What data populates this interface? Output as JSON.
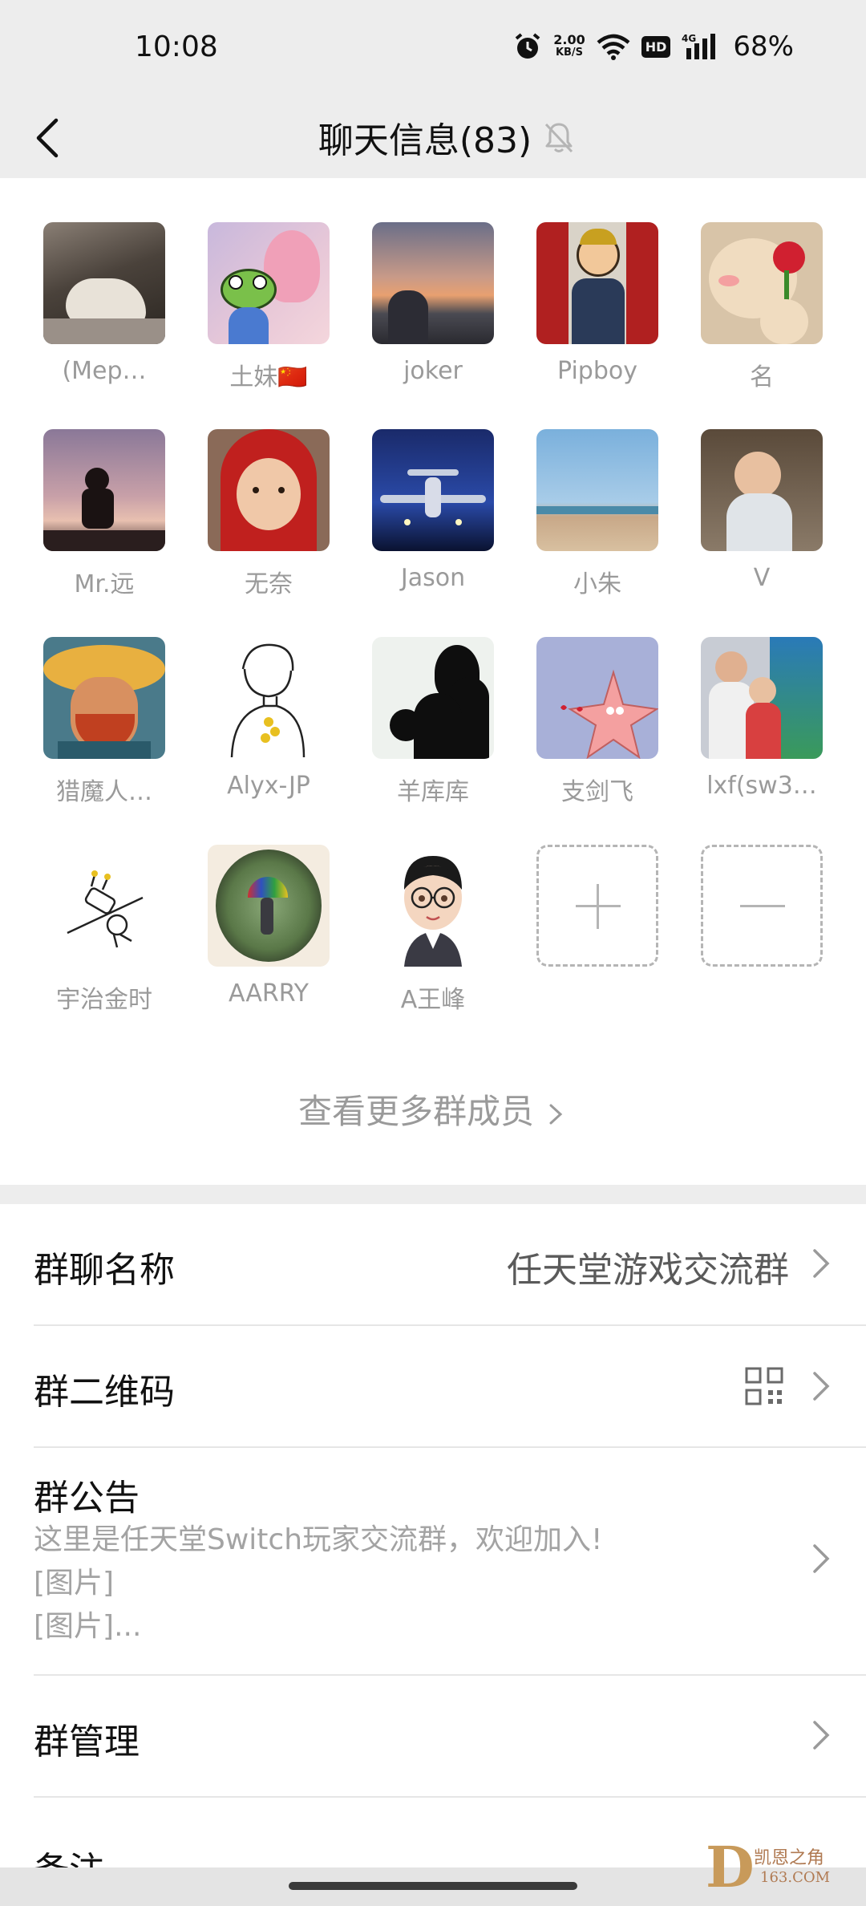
{
  "status_bar": {
    "time": "10:08",
    "speed_value": "2.00",
    "speed_unit": "KB/S",
    "hd_label": "HD",
    "network": "4G",
    "battery": "68%"
  },
  "nav": {
    "title": "聊天信息(83)"
  },
  "members": [
    {
      "name": "(Mep…",
      "avatar": "cat-on-sofa"
    },
    {
      "name": "土妹🇨🇳",
      "avatar": "frog-lotus"
    },
    {
      "name": "joker",
      "avatar": "sunset-city"
    },
    {
      "name": "Pipboy",
      "avatar": "pipboy-cartoon"
    },
    {
      "name": "名",
      "avatar": "cat-rose"
    },
    {
      "name": "Mr.远",
      "avatar": "silhouette-dusk"
    },
    {
      "name": "无奈",
      "avatar": "baby-red-hood"
    },
    {
      "name": "Jason",
      "avatar": "airplane-night"
    },
    {
      "name": "小朱",
      "avatar": "beach-sky"
    },
    {
      "name": "V",
      "avatar": "baby-sitting"
    },
    {
      "name": "猎魔人…",
      "avatar": "van-gogh-portrait"
    },
    {
      "name": "Alyx-JP",
      "avatar": "line-drawing-boy"
    },
    {
      "name": "羊库库",
      "avatar": "girl-silhouette"
    },
    {
      "name": "支剑飞",
      "avatar": "patrick-star"
    },
    {
      "name": "lxf(sw3…",
      "avatar": "kids-globe"
    },
    {
      "name": "宇治金时",
      "avatar": "fallen-doodle"
    },
    {
      "name": "AARRY",
      "avatar": "rain-umbrella"
    },
    {
      "name": "A王峰",
      "avatar": "cartoon-man-glasses"
    }
  ],
  "actions": {
    "add_icon": "plus-icon",
    "remove_icon": "minus-icon"
  },
  "view_more": "查看更多群成员",
  "settings": {
    "group_name_label": "群聊名称",
    "group_name_value": "任天堂游戏交流群",
    "qr_label": "群二维码",
    "notice_label": "群公告",
    "notice_line1": "这里是任天堂Switch玩家交流群，欢迎加入!",
    "notice_line2": "[图片]",
    "notice_line3": "[图片]...",
    "manage_label": "群管理",
    "remark_label": "备注"
  },
  "watermark": {
    "line1": "凯恩之角",
    "line2": "163.COM"
  }
}
